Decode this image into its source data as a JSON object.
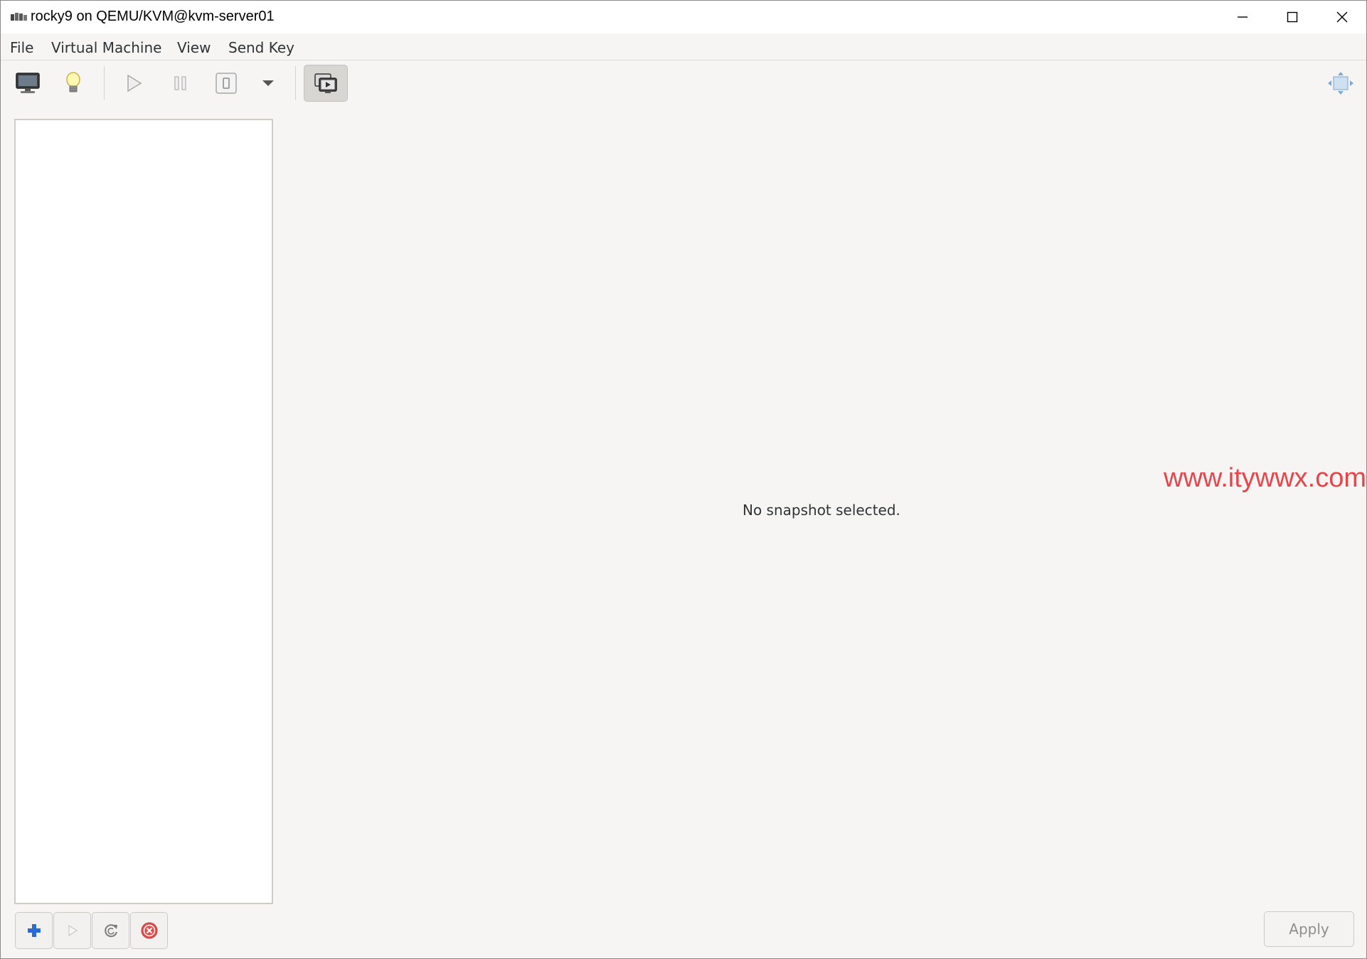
{
  "window": {
    "title": "rocky9 on QEMU/KVM@kvm-server01",
    "app_icon": "virt-manager-icon"
  },
  "menubar": {
    "items": [
      {
        "label": "File"
      },
      {
        "label": "Virtual Machine"
      },
      {
        "label": "View"
      },
      {
        "label": "Send Key"
      }
    ]
  },
  "toolbar": {
    "icons": [
      "console-monitor-icon",
      "details-lightbulb-icon",
      "run-play-icon",
      "pause-icon",
      "shutdown-icon",
      "shutdown-menu-chevron-icon",
      "snapshots-icon",
      "fullscreen-icon"
    ]
  },
  "main": {
    "empty_message": "No snapshot selected.",
    "watermark": "www.itywwx.com"
  },
  "footer": {
    "apply_label": "Apply",
    "icons": [
      "add-snapshot-icon",
      "run-snapshot-icon",
      "refresh-icon",
      "delete-snapshot-icon"
    ]
  },
  "colors": {
    "window_bg": "#f6f5f4",
    "list_bg": "#ffffff",
    "watermark": "#e8444a",
    "add_icon": "#2a6bd8",
    "delete_icon": "#e24d4d"
  }
}
